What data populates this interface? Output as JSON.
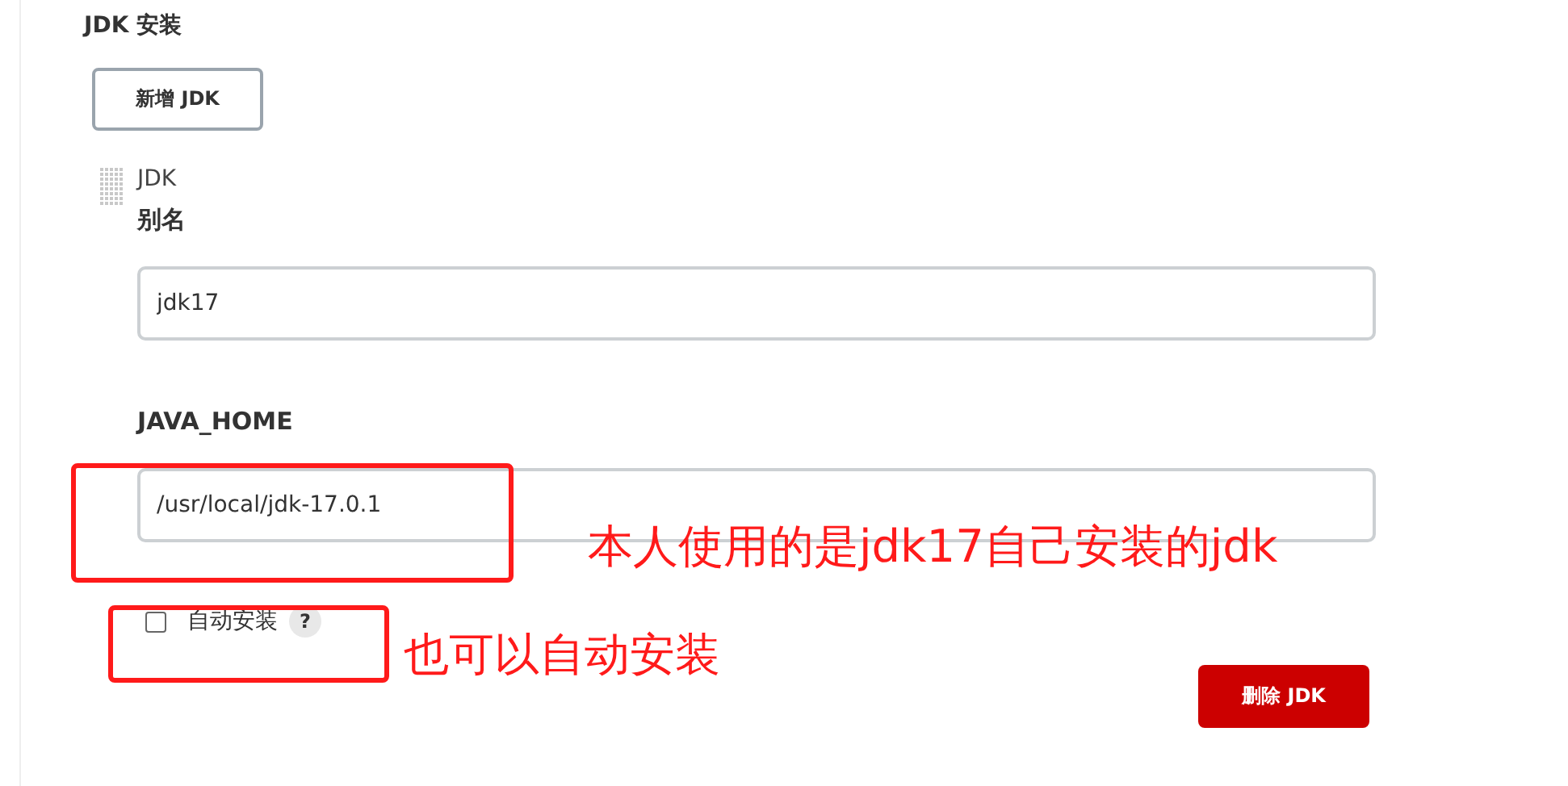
{
  "section_title": "JDK 安装",
  "add_button": "新增 JDK",
  "item": {
    "title": "JDK",
    "alias_label": "别名",
    "alias_value": "jdk17",
    "home_label": "JAVA_HOME",
    "home_value": "/usr/local/jdk-17.0.1",
    "auto_install": {
      "label": "自动安装",
      "checked": false,
      "help": "?"
    },
    "delete_button": "删除 JDK"
  },
  "annotations": [
    {
      "text": "本人使用的是jdk17自己安装的jdk"
    },
    {
      "text": "也可以自动安装"
    }
  ]
}
